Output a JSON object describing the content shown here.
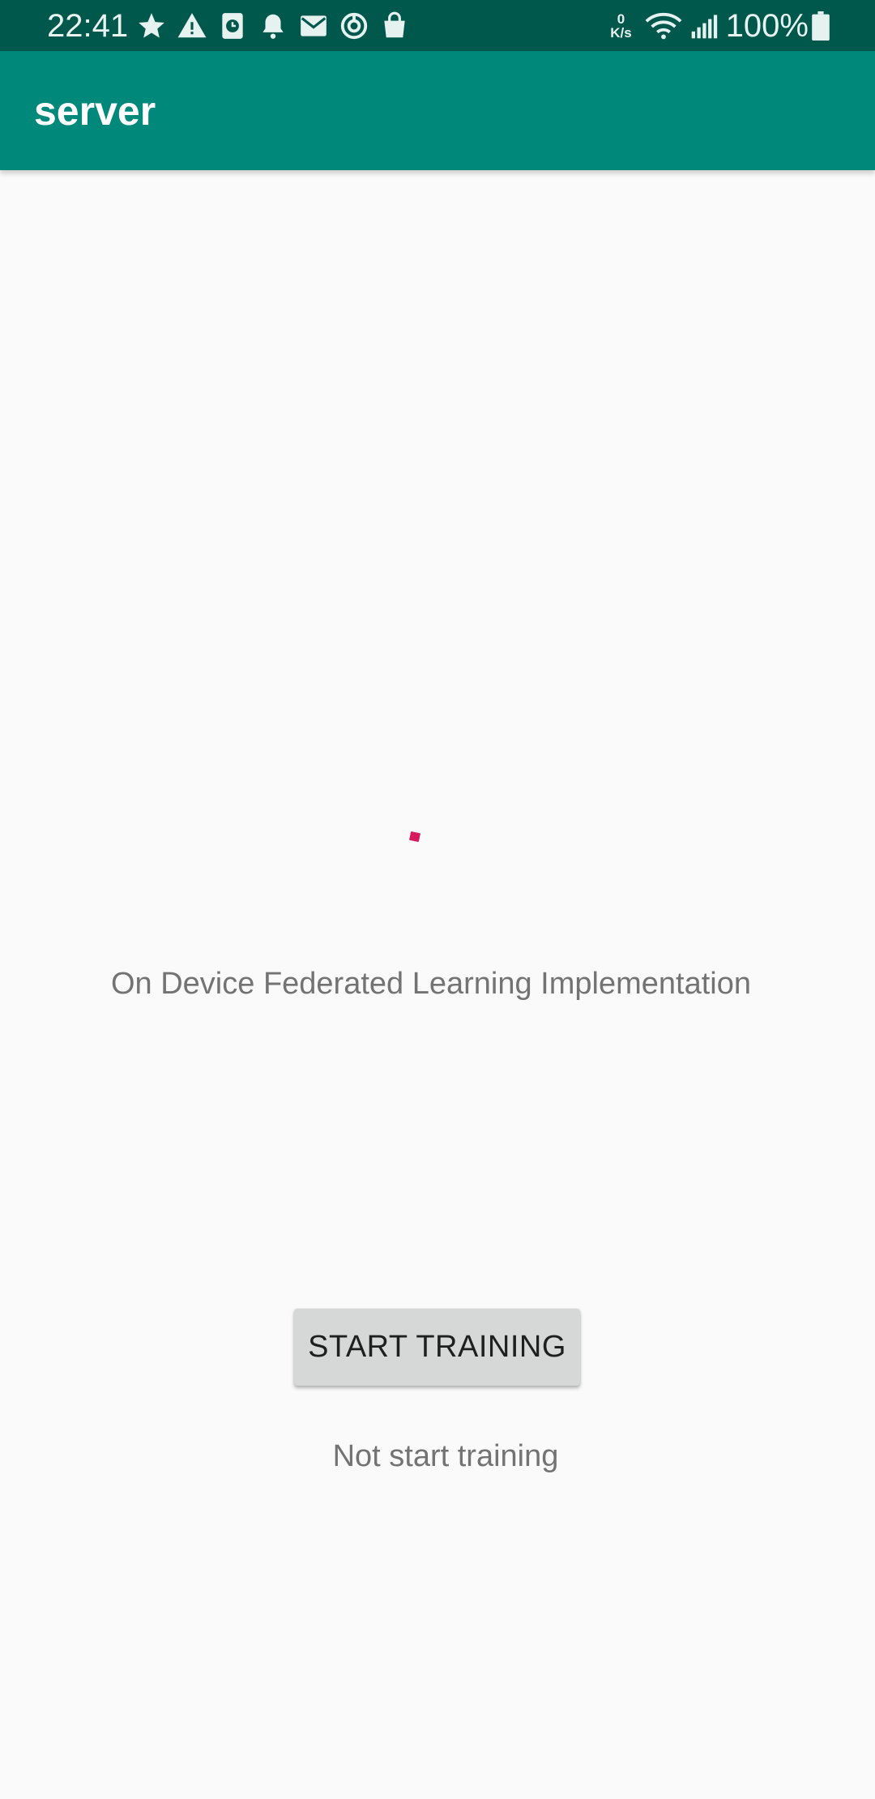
{
  "status_bar": {
    "time": "22:41",
    "left_icons": [
      "star-icon",
      "warning-icon",
      "clock-app-icon",
      "bell-icon",
      "mail-icon",
      "sync-icon",
      "shopping-bag-icon"
    ],
    "net_speed_value": "0",
    "net_speed_unit": "K/s",
    "battery": "100%"
  },
  "app_bar": {
    "title": "server"
  },
  "main": {
    "headline": "On Device Federated Learning Implementation",
    "button_label": "START TRAINING",
    "training_status": "Not start training"
  },
  "colors": {
    "status_bar": "#00584c",
    "app_bar": "#00897b",
    "background": "#fafafa",
    "accent": "#d81b60",
    "button": "#d6d7d7"
  }
}
